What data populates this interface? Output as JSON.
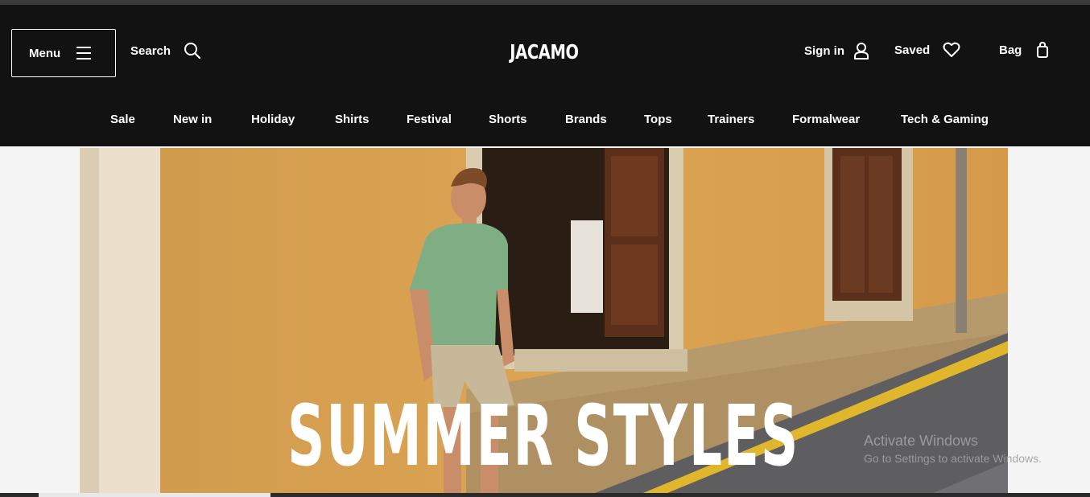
{
  "header": {
    "menu_label": "Menu",
    "search_label": "Search",
    "logo": "JACAMO",
    "signin_label": "Sign in",
    "saved_label": "Saved",
    "bag_label": "Bag"
  },
  "nav": [
    {
      "label": "Sale"
    },
    {
      "label": "New in"
    },
    {
      "label": "Holiday"
    },
    {
      "label": "Shirts"
    },
    {
      "label": "Festival"
    },
    {
      "label": "Shorts"
    },
    {
      "label": "Brands"
    },
    {
      "label": "Tops"
    },
    {
      "label": "Trainers"
    },
    {
      "label": "Formalwear"
    },
    {
      "label": "Tech & Gaming"
    }
  ],
  "hero": {
    "headline": "SUMMER STYLES"
  },
  "watermark": {
    "title": "Activate Windows",
    "subtitle": "Go to Settings to activate Windows."
  },
  "colors": {
    "header_bg": "#121212",
    "page_bg": "#f4f4f4",
    "wall": "#d8a04d",
    "shirt": "#7fae85"
  },
  "icons": [
    "hamburger-icon",
    "search-icon",
    "user-icon",
    "heart-icon",
    "bag-icon"
  ]
}
